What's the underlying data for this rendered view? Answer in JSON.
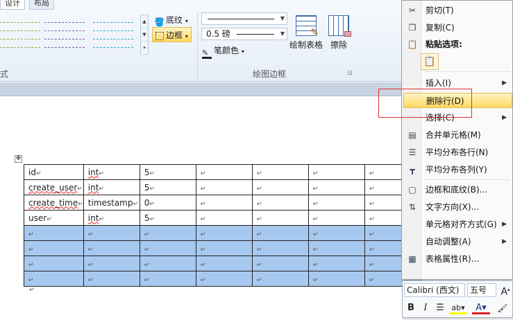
{
  "ribbon": {
    "tabs": [
      "设计",
      "布局"
    ],
    "left_group_label": "式",
    "shading_label": "底纹",
    "borders_label": "边框",
    "line_weight_value": "0.5 磅",
    "pen_color_label": "笔颜色",
    "draw_table_label": "绘制表格",
    "eraser_label": "擦除",
    "draw_borders_group_label": "绘图边框"
  },
  "table": {
    "rows": [
      [
        "id",
        "int",
        "5",
        "",
        "",
        "",
        ""
      ],
      [
        "create_user",
        "int",
        "5",
        "",
        "",
        "",
        ""
      ],
      [
        "create_time",
        "timestamp",
        "0",
        "",
        "",
        "",
        ""
      ],
      [
        "user",
        "int",
        "5",
        "",
        "",
        "",
        ""
      ],
      [
        "",
        "",
        "",
        "",
        "",
        "",
        ""
      ],
      [
        "",
        "",
        "",
        "",
        "",
        "",
        ""
      ],
      [
        "",
        "",
        "",
        "",
        "",
        "",
        ""
      ],
      [
        "",
        "",
        "",
        "",
        "",
        "",
        ""
      ]
    ],
    "selected_rows": [
      4,
      5,
      6,
      7
    ],
    "return_mark": "↵"
  },
  "context_menu": {
    "items": [
      {
        "label": "剪切(T)",
        "icon": "scissors-icon",
        "glyph": "✂"
      },
      {
        "label": "复制(C)",
        "icon": "copy-icon",
        "glyph": "❐"
      },
      {
        "label": "粘贴选项:",
        "icon": "paste-icon",
        "glyph": "📋"
      },
      {
        "label": "插入(I)",
        "icon": "",
        "glyph": "",
        "submenu": true
      },
      {
        "label": "删除行(D)",
        "icon": "",
        "glyph": "",
        "highlighted": true
      },
      {
        "label": "选择(C)",
        "icon": "",
        "glyph": "",
        "submenu": true
      },
      {
        "label": "合并单元格(M)",
        "icon": "merge-cells-icon",
        "glyph": "▤"
      },
      {
        "label": "平均分布各行(N)",
        "icon": "distribute-rows-icon",
        "glyph": "☰"
      },
      {
        "label": "平均分布各列(Y)",
        "icon": "distribute-columns-icon",
        "glyph": "┳"
      },
      {
        "label": "边框和底纹(B)...",
        "icon": "borders-shading-icon",
        "glyph": "▢"
      },
      {
        "label": "文字方向(X)...",
        "icon": "text-direction-icon",
        "glyph": "⇅"
      },
      {
        "label": "单元格对齐方式(G)",
        "icon": "",
        "glyph": "",
        "submenu": true
      },
      {
        "label": "自动调整(A)",
        "icon": "",
        "glyph": "",
        "submenu": true
      },
      {
        "label": "表格属性(R)...",
        "icon": "table-properties-icon",
        "glyph": "▦"
      }
    ]
  },
  "mini_toolbar": {
    "font_name": "Calibri (西文)",
    "font_size": "五号"
  },
  "colors": {
    "selection": "#a7c9ef",
    "highlight_menu": "#ffd963",
    "annotation_box": "#e03030",
    "font_color": "#e02020",
    "highlighter": "#ffff00"
  }
}
